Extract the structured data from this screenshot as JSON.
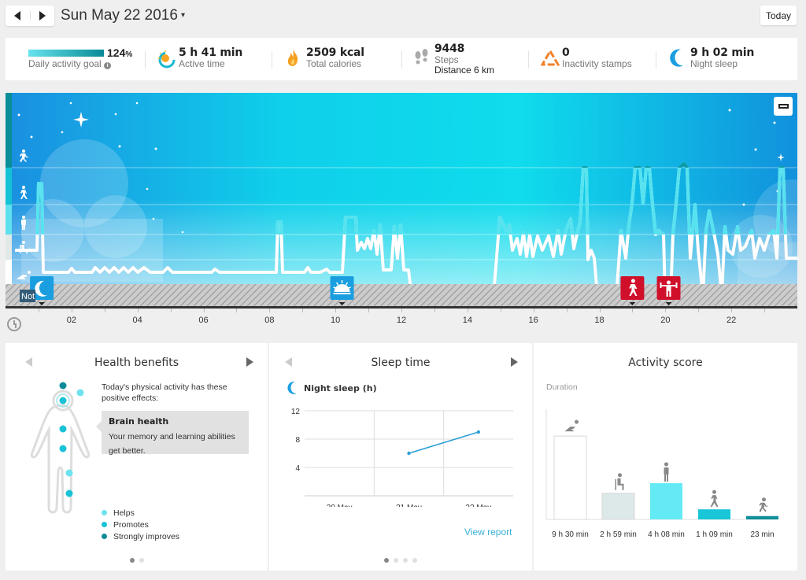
{
  "header": {
    "prev_label": "Previous day",
    "next_label": "Next day",
    "date": "Sun May 22 2016",
    "date_caret": "▾",
    "today_button": "Today"
  },
  "summary": {
    "goal": {
      "percent": 124,
      "percent_text": "124",
      "percent_sign": "%",
      "label": "Daily activity goal",
      "info_icon": "i",
      "bar_fill_fraction": 1.0
    },
    "active_time": {
      "value": "5 h 41 min",
      "label": "Active time",
      "icon": "sun-icon"
    },
    "calories": {
      "value": "2509 kcal",
      "label": "Total calories",
      "icon": "flame-icon"
    },
    "steps": {
      "value": "9448",
      "label": "Steps",
      "distance": "Distance 6 km",
      "icon": "footprints-icon"
    },
    "inactivity": {
      "value": "0",
      "label": "Inactivity stamps",
      "icon": "warning-triangle-icon"
    },
    "sleep": {
      "value": "9 h 02 min",
      "label": "Night sleep",
      "icon": "moon-icon"
    }
  },
  "timeline": {
    "not_worn_label": "Not",
    "hour_ticks": [
      "02",
      "04",
      "06",
      "08",
      "10",
      "12",
      "14",
      "16",
      "18",
      "20",
      "22"
    ],
    "hour_tick_values": [
      2,
      4,
      6,
      8,
      10,
      12,
      14,
      16,
      18,
      20,
      22
    ],
    "levels": [
      "running",
      "walking",
      "standing",
      "sitting",
      "resting"
    ],
    "markers": [
      {
        "type": "sleep",
        "icon": "moon-icon",
        "hour": 1.1,
        "color": "#1b9ee0"
      },
      {
        "type": "wake",
        "icon": "sunrise-icon",
        "hour": 10.2,
        "color": "#1b9ee0"
      },
      {
        "type": "walk",
        "icon": "walking-icon",
        "hour": 19.0,
        "color": "#d0102b"
      },
      {
        "type": "gym",
        "icon": "weightlifting-icon",
        "hour": 20.1,
        "color": "#d0102b"
      }
    ],
    "collapse_button": "collapse"
  },
  "panels": {
    "health": {
      "title": "Health benefits",
      "intro": "Today's physical activity has these positive effects:",
      "callout_title": "Brain health",
      "callout_text": "Your memory and learning abilities get better.",
      "legend": [
        {
          "label": "Helps",
          "color": "#6fe2ef"
        },
        {
          "label": "Promotes",
          "color": "#19c2d6"
        },
        {
          "label": "Strongly improves",
          "color": "#0f8a99"
        }
      ],
      "page": 1,
      "pages": 2
    },
    "sleep": {
      "title": "Sleep time",
      "subtitle": "Night sleep (h)",
      "view_report": "View report",
      "page": 1,
      "pages": 4
    },
    "activity": {
      "title": "Activity score",
      "ylabel": "Duration"
    }
  },
  "chart_data": [
    {
      "type": "line",
      "title": "Night sleep (h)",
      "categories": [
        "20 May",
        "21 May",
        "22 May"
      ],
      "values": [
        null,
        6,
        9
      ],
      "yticks": [
        4,
        8,
        12
      ],
      "ylim": [
        0,
        12
      ],
      "grid": true,
      "color": "#2a9fd6"
    },
    {
      "type": "bar",
      "title": "Activity score",
      "ylabel": "Duration",
      "categories": [
        "Resting",
        "Sitting",
        "Standing",
        "Walking",
        "Running"
      ],
      "values_min": [
        570,
        179,
        248,
        69,
        23
      ],
      "labels": [
        "9 h 30 min",
        "2 h 59 min",
        "4 h 08 min",
        "1 h 09 min",
        "23 min"
      ],
      "colors": [
        "#ffffff",
        "#dde8e8",
        "#64eaf4",
        "#18c6d8",
        "#0f8f9a"
      ],
      "icons": [
        "lying-icon",
        "sitting-icon",
        "standing-icon",
        "walking-icon",
        "running-icon"
      ]
    }
  ]
}
